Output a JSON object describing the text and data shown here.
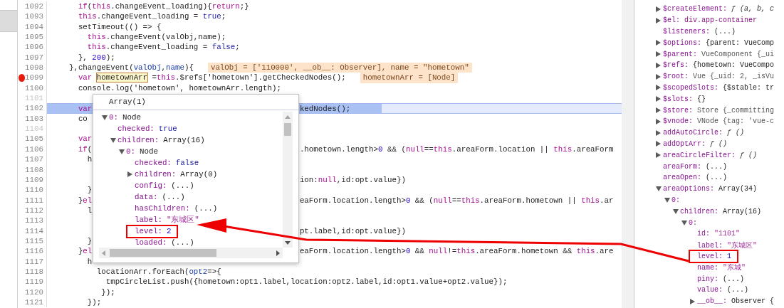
{
  "navigator": {
    "items": [
      {
        "selected": true
      }
    ]
  },
  "editor": {
    "lines": [
      {
        "number": "1092",
        "breakpoint": false,
        "current": false,
        "faded": false,
        "code": [
          {
            "t": "      if",
            "kind": "kw"
          },
          {
            "t": "(",
            "kind": "p"
          },
          {
            "t": "this",
            "kind": "kw"
          },
          {
            "t": ".changeEvent_loading){",
            "kind": "p"
          },
          {
            "t": "return",
            "kind": "kw"
          },
          {
            "t": ";}",
            "kind": "p"
          }
        ]
      },
      {
        "number": "1093",
        "breakpoint": false,
        "current": false,
        "faded": false,
        "code": [
          {
            "t": "      this",
            "kind": "kw"
          },
          {
            "t": ".changeEvent_loading = ",
            "kind": "p"
          },
          {
            "t": "true",
            "kind": "lit"
          },
          {
            "t": ";",
            "kind": "p"
          }
        ]
      },
      {
        "number": "1094",
        "breakpoint": false,
        "current": false,
        "faded": false,
        "code": [
          {
            "t": "      setTimeout(() => {",
            "kind": "p"
          }
        ]
      },
      {
        "number": "1095",
        "breakpoint": false,
        "current": false,
        "faded": false,
        "code": [
          {
            "t": "        this",
            "kind": "kw"
          },
          {
            "t": ".changeEvent(valObj,name);",
            "kind": "p"
          }
        ]
      },
      {
        "number": "1096",
        "breakpoint": false,
        "current": false,
        "faded": false,
        "code": [
          {
            "t": "        this",
            "kind": "kw"
          },
          {
            "t": ".changeEvent_loading = ",
            "kind": "p"
          },
          {
            "t": "false",
            "kind": "lit"
          },
          {
            "t": ";",
            "kind": "p"
          }
        ]
      },
      {
        "number": "1097",
        "breakpoint": false,
        "current": false,
        "faded": false,
        "code": [
          {
            "t": "      }, ",
            "kind": "p"
          },
          {
            "t": "200",
            "kind": "num"
          },
          {
            "t": ");",
            "kind": "p"
          }
        ]
      },
      {
        "number": "1098",
        "breakpoint": false,
        "current": false,
        "faded": false,
        "code": [
          {
            "t": "    },changeEvent(",
            "kind": "p"
          },
          {
            "t": "valObj",
            "kind": "var"
          },
          {
            "t": ",",
            "kind": "p"
          },
          {
            "t": "name",
            "kind": "var"
          },
          {
            "t": "){",
            "kind": "p"
          }
        ],
        "inline_value": "valObj = ['110000', __ob__: Observer], name = \"hometown\""
      },
      {
        "number": "1099",
        "breakpoint": true,
        "current": false,
        "faded": false,
        "code": [
          {
            "t": "      var ",
            "kind": "kw"
          },
          {
            "t": "hometownArr",
            "kind": "hover"
          },
          {
            "t": " =",
            "kind": "p"
          },
          {
            "t": "this",
            "kind": "kw"
          },
          {
            "t": ".$refs['hometown'].getCheckedNodes();",
            "kind": "p"
          }
        ],
        "inline_value": "hometownArr = [Node]"
      },
      {
        "number": "1100",
        "breakpoint": false,
        "current": false,
        "faded": false,
        "code": [
          {
            "t": "      console.log('hometown', hometownArr.length);",
            "kind": "p"
          }
        ]
      },
      {
        "number": "1101",
        "breakpoint": false,
        "current": false,
        "faded": true
      },
      {
        "number": "1102",
        "breakpoint": false,
        "current": true,
        "faded": false,
        "code": [
          {
            "t": "      var",
            "kind": "kw"
          }
        ],
        "tail": [
          {
            "t": "kedNodes();",
            "kind": "p"
          }
        ]
      },
      {
        "number": "1103",
        "breakpoint": false,
        "current": false,
        "faded": false,
        "code": [
          {
            "t": "      co",
            "kind": "p"
          }
        ]
      },
      {
        "number": "1104",
        "breakpoint": false,
        "current": false,
        "faded": true
      },
      {
        "number": "1105",
        "breakpoint": false,
        "current": false,
        "faded": false,
        "code": [
          {
            "t": "      var",
            "kind": "kw"
          }
        ]
      },
      {
        "number": "1106",
        "breakpoint": false,
        "current": false,
        "faded": false,
        "code": [
          {
            "t": "      if",
            "kind": "kw"
          },
          {
            "t": "(",
            "kind": "p"
          }
        ],
        "tail": [
          {
            "t": ".hometown.length>",
            "kind": "p"
          },
          {
            "t": "0",
            "kind": "num"
          },
          {
            "t": " && (",
            "kind": "p"
          },
          {
            "t": "null",
            "kind": "kw"
          },
          {
            "t": "==",
            "kind": "p"
          },
          {
            "t": "this",
            "kind": "kw"
          },
          {
            "t": ".areaForm.location || ",
            "kind": "p"
          },
          {
            "t": "this",
            "kind": "kw"
          },
          {
            "t": ".areaForm",
            "kind": "p"
          }
        ]
      },
      {
        "number": "1107",
        "breakpoint": false,
        "current": false,
        "faded": false,
        "code": [
          {
            "t": "        h",
            "kind": "p"
          }
        ]
      },
      {
        "number": "1108",
        "breakpoint": false,
        "current": false,
        "faded": false
      },
      {
        "number": "1109",
        "breakpoint": false,
        "current": false,
        "faded": false,
        "tail": [
          {
            "t": "ion:",
            "kind": "p"
          },
          {
            "t": "null",
            "kind": "kw"
          },
          {
            "t": ",id:opt.value})",
            "kind": "p"
          }
        ]
      },
      {
        "number": "1110",
        "breakpoint": false,
        "current": false,
        "faded": false,
        "code": [
          {
            "t": "        }",
            "kind": "p"
          }
        ]
      },
      {
        "number": "1111",
        "breakpoint": false,
        "current": false,
        "faded": false,
        "code": [
          {
            "t": "      }",
            "kind": "p"
          },
          {
            "t": "el",
            "kind": "kw"
          }
        ],
        "tail": [
          {
            "t": "eaForm.location.length>",
            "kind": "p"
          },
          {
            "t": "0",
            "kind": "num"
          },
          {
            "t": " && (",
            "kind": "p"
          },
          {
            "t": "null",
            "kind": "kw"
          },
          {
            "t": "==",
            "kind": "p"
          },
          {
            "t": "this",
            "kind": "kw"
          },
          {
            "t": ".areaForm.hometown || ",
            "kind": "p"
          },
          {
            "t": "this",
            "kind": "kw"
          },
          {
            "t": ".ar",
            "kind": "p"
          }
        ]
      },
      {
        "number": "1112",
        "breakpoint": false,
        "current": false,
        "faded": false,
        "code": [
          {
            "t": "        l",
            "kind": "p"
          }
        ]
      },
      {
        "number": "1113",
        "breakpoint": false,
        "current": false,
        "faded": false
      },
      {
        "number": "1114",
        "breakpoint": false,
        "current": false,
        "faded": false,
        "tail": [
          {
            "t": "pt.label,id:opt.value})",
            "kind": "p"
          }
        ]
      },
      {
        "number": "1115",
        "breakpoint": false,
        "current": false,
        "faded": false,
        "code": [
          {
            "t": "        }",
            "kind": "p"
          }
        ]
      },
      {
        "number": "1116",
        "breakpoint": false,
        "current": false,
        "faded": false,
        "code": [
          {
            "t": "      }",
            "kind": "p"
          },
          {
            "t": "el",
            "kind": "kw"
          }
        ],
        "tail": [
          {
            "t": "eaForm.location.length>",
            "kind": "p"
          },
          {
            "t": "0",
            "kind": "num"
          },
          {
            "t": " && ",
            "kind": "p"
          },
          {
            "t": "null",
            "kind": "kw"
          },
          {
            "t": "!=",
            "kind": "p"
          },
          {
            "t": "this",
            "kind": "kw"
          },
          {
            "t": ".areaForm.hometown && ",
            "kind": "p"
          },
          {
            "t": "this",
            "kind": "kw"
          },
          {
            "t": ".are",
            "kind": "p"
          }
        ]
      },
      {
        "number": "1117",
        "breakpoint": false,
        "current": false,
        "faded": false,
        "code": [
          {
            "t": "        h",
            "kind": "p"
          }
        ]
      },
      {
        "number": "1118",
        "breakpoint": false,
        "current": false,
        "faded": false,
        "code": [
          {
            "t": "          locationArr.forEach(",
            "kind": "p"
          },
          {
            "t": "opt2",
            "kind": "var"
          },
          {
            "t": "=>{",
            "kind": "p"
          }
        ]
      },
      {
        "number": "1119",
        "breakpoint": false,
        "current": false,
        "faded": false,
        "code": [
          {
            "t": "            tmpCircleList.push({hometown:opt1.label,location:opt2.label,id:opt1.value+opt2.value});",
            "kind": "p"
          }
        ]
      },
      {
        "number": "1120",
        "breakpoint": false,
        "current": false,
        "faded": false,
        "code": [
          {
            "t": "           });",
            "kind": "p"
          }
        ]
      },
      {
        "number": "1121",
        "breakpoint": false,
        "current": false,
        "faded": false,
        "code": [
          {
            "t": "        });",
            "kind": "p"
          }
        ]
      }
    ]
  },
  "popup": {
    "title": "Array(1)",
    "tree": [
      {
        "key": "0:",
        "value": "Node",
        "expanded": true,
        "children": [
          {
            "key": "checked:",
            "value": "true",
            "kind": "lit"
          },
          {
            "key": "children:",
            "value": "Array(16)",
            "expanded": true,
            "children": [
              {
                "key": "0:",
                "value": "Node",
                "expanded": true,
                "children": [
                  {
                    "key": "checked:",
                    "value": "false",
                    "kind": "lit"
                  },
                  {
                    "key": "children:",
                    "value": "Array(0)",
                    "expanded": false
                  },
                  {
                    "key": "config:",
                    "value": "(...)"
                  },
                  {
                    "key": "data:",
                    "value": "(...)"
                  },
                  {
                    "key": "hasChildren:",
                    "value": "(...)"
                  },
                  {
                    "key": "label:",
                    "value": "\"东城区\"",
                    "kind": "str"
                  },
                  {
                    "key": "level:",
                    "value": "2",
                    "kind": "num",
                    "highlighted": true
                  },
                  {
                    "key": "loaded:",
                    "value": "(...)"
                  }
                ]
              }
            ]
          }
        ]
      }
    ]
  },
  "scope": {
    "tree": [
      {
        "key": "$createElement:",
        "value": "ƒ (a, b, c",
        "kind": "func",
        "expanded": false
      },
      {
        "key": "$el:",
        "value": "div.app-container",
        "kind": "node",
        "expanded": false
      },
      {
        "key": "$listeners:",
        "value": "(...)"
      },
      {
        "key": "$options:",
        "value": "{parent: VueComp",
        "expanded": false
      },
      {
        "key": "$parent:",
        "value": "VueComponent {_ui",
        "kind": "obj",
        "expanded": false
      },
      {
        "key": "$refs:",
        "value": "{hometown: VueCompo",
        "expanded": false
      },
      {
        "key": "$root:",
        "value": "Vue {_uid: 2, _isVu",
        "kind": "obj",
        "expanded": false
      },
      {
        "key": "$scopedSlots:",
        "value": "{$stable: tr",
        "expanded": false
      },
      {
        "key": "$slots:",
        "value": "{}",
        "expanded": false
      },
      {
        "key": "$store:",
        "value": "Store {_committing",
        "kind": "obj",
        "expanded": false
      },
      {
        "key": "$vnode:",
        "value": "VNode {tag: 'vue-c",
        "kind": "obj",
        "expanded": false
      },
      {
        "key": "addAutoCircle:",
        "value": "ƒ ()",
        "kind": "func",
        "expanded": false
      },
      {
        "key": "addOptArr:",
        "value": "ƒ ()",
        "kind": "func",
        "expanded": false
      },
      {
        "key": "areaCircleFilter:",
        "value": "ƒ ()",
        "kind": "func",
        "expanded": false
      },
      {
        "key": "areaForm:",
        "value": "(...)"
      },
      {
        "key": "areaOpen:",
        "value": "(...)"
      },
      {
        "key": "areaOptions:",
        "value": "Array(34)",
        "expanded": true,
        "children": [
          {
            "key": "0:",
            "expanded": true,
            "children": [
              {
                "key": "children:",
                "value": "Array(16)",
                "expanded": true,
                "children": [
                  {
                    "key": "0:",
                    "expanded": true,
                    "children": [
                      {
                        "key": "id:",
                        "value": "\"1101\"",
                        "kind": "str"
                      },
                      {
                        "key": "label:",
                        "value": "\"东城区\"",
                        "kind": "str"
                      },
                      {
                        "key": "level:",
                        "value": "1",
                        "kind": "num",
                        "highlighted": true
                      },
                      {
                        "key": "name:",
                        "value": "\"东城\"",
                        "kind": "str"
                      },
                      {
                        "key": "piny:",
                        "value": "(...)"
                      },
                      {
                        "key": "value:",
                        "value": "(...)"
                      },
                      {
                        "key": "__ob__:",
                        "value": "Observer {",
                        "expanded": false
                      }
                    ]
                  }
                ]
              }
            ]
          }
        ]
      }
    ]
  }
}
